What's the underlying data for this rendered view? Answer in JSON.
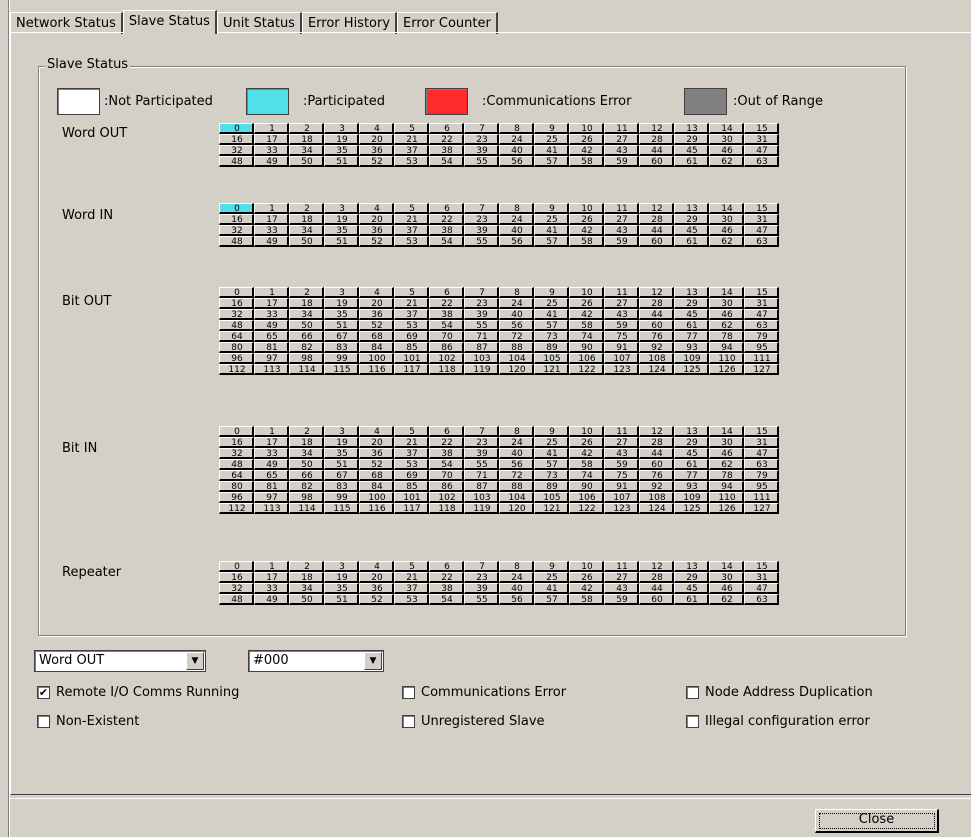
{
  "tabs": [
    "Network Status",
    "Slave Status",
    "Unit Status",
    "Error History",
    "Error Counter"
  ],
  "group_title": "Slave Status",
  "legend": [
    {
      "label": ":Not Participated",
      "color": "#ffffff"
    },
    {
      "label": ":Participated",
      "color": "#4fe0e8"
    },
    {
      "label": ":Communications Error",
      "color": "#ff2a2a"
    },
    {
      "label": ":Out of Range",
      "color": "#808080"
    }
  ],
  "sections": [
    {
      "label": "Word OUT",
      "count": 64,
      "participated": [
        0
      ]
    },
    {
      "label": "Word IN",
      "count": 64,
      "participated": [
        0
      ]
    },
    {
      "label": "Bit OUT",
      "count": 128,
      "participated": []
    },
    {
      "label": "Bit IN",
      "count": 128,
      "participated": []
    },
    {
      "label": "Repeater",
      "count": 64,
      "participated": []
    }
  ],
  "selectors": {
    "type_value": "Word OUT",
    "node_value": "#000"
  },
  "checks": [
    {
      "label": "Remote I/O Comms Running",
      "checked": true
    },
    {
      "label": "Communications Error",
      "checked": false
    },
    {
      "label": "Node Address Duplication",
      "checked": false
    },
    {
      "label": "Non-Existent",
      "checked": false
    },
    {
      "label": "Unregistered Slave",
      "checked": false
    },
    {
      "label": "Illegal configuration error",
      "checked": false
    }
  ],
  "close_label": "Close"
}
